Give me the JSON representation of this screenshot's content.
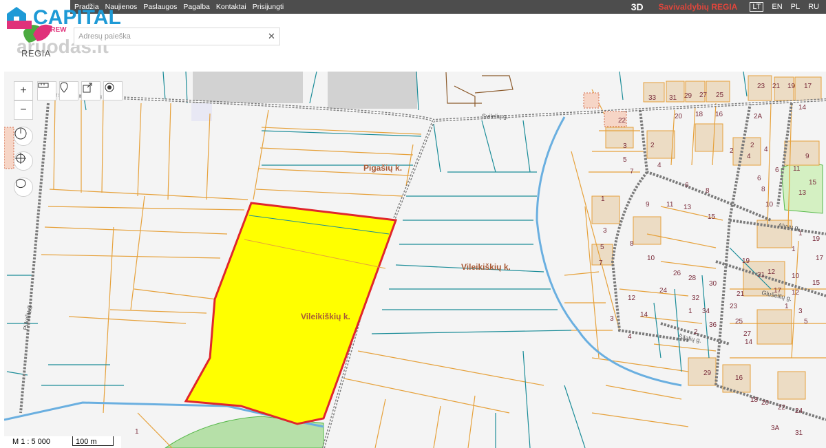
{
  "nav": {
    "items": [
      "Pradžia",
      "Naujienos",
      "Paslaugos",
      "Pagalba",
      "Kontaktai",
      "Prisijungti"
    ]
  },
  "header": {
    "mode_3d": "3D",
    "brand": "Savivaldybių REGIA",
    "languages": [
      "LT",
      "EN",
      "PL",
      "RU"
    ],
    "active_language": "LT"
  },
  "logo": {
    "capital": "CAPITAL",
    "crew": "CREW",
    "regia": "REGIA"
  },
  "watermark": "aruodas.lt",
  "search": {
    "placeholder": "Adresų paieška",
    "value": ""
  },
  "map": {
    "place_labels": [
      "Pigašių k.",
      "Vileikiškių k.",
      "Vileikiškių k."
    ],
    "street_labels": [
      "Svilelių g.",
      "Alyvų g.",
      "Glušellių g.",
      "Šilalių g.",
      "Pilkelių g."
    ],
    "parcel_numbers": [
      "33",
      "31",
      "29",
      "27",
      "25",
      "23",
      "21",
      "19",
      "17",
      "16",
      "14",
      "22",
      "20",
      "18",
      "3",
      "2",
      "2",
      "4",
      "6",
      "8",
      "5",
      "7",
      "9",
      "11",
      "13",
      "15",
      "1",
      "3",
      "5",
      "7",
      "8",
      "10",
      "12",
      "14",
      "24",
      "26",
      "28",
      "30",
      "32",
      "34",
      "36",
      "21",
      "23",
      "25",
      "27",
      "29",
      "16",
      "18",
      "20",
      "22",
      "24",
      "3A",
      "31",
      "1",
      "4",
      "6",
      "4",
      "2",
      "2A",
      "6",
      "8",
      "10",
      "12",
      "17",
      "19",
      "21",
      "1",
      "3",
      "5",
      "14",
      "11",
      "9",
      "15",
      "13",
      "12",
      "10",
      "15",
      "17",
      "19",
      "1",
      "2",
      "3",
      "4",
      "1",
      "1"
    ],
    "highlight_color": "#ffff00",
    "highlight_border": "#e0262c",
    "lot_color": "#e6a13b",
    "road_color": "#7a7a7a",
    "water_color": "#6aafe0",
    "tools": [
      "zoom-in",
      "zoom-out",
      "measure-distance",
      "place-marker",
      "share",
      "locate",
      "north-compass",
      "target",
      "draw-polygon"
    ]
  },
  "scale": {
    "ratio": "M 1 : 5 000",
    "bar_label": "100 m"
  }
}
